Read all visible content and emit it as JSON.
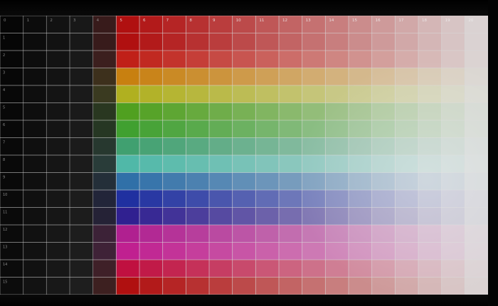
{
  "header_labels": [
    "0",
    "1",
    "2",
    "3",
    "4",
    "5",
    "6",
    "7",
    "8",
    "9",
    "10",
    "11",
    "12",
    "13",
    "14",
    "15",
    "16",
    "17",
    "18",
    "19",
    "20"
  ],
  "row_labels": [
    "1",
    "2",
    "3",
    "4",
    "5",
    "6",
    "7",
    "8",
    "9",
    "10",
    "11",
    "12",
    "13",
    "14",
    "15"
  ],
  "colors": {
    "bezel": "#000000",
    "gridline": "#d8d8d8",
    "saturated_row_0": "#b01010",
    "saturated_row_1": "#c02018",
    "saturated_row_2": "#c88010",
    "saturated_row_3": "#b0b020",
    "saturated_row_4": "#50a020",
    "saturated_row_5": "#40a030",
    "saturated_row_6": "#40a070",
    "saturated_row_7": "#50b8a8",
    "saturated_row_8": "#3070a8",
    "saturated_row_9": "#2030a0",
    "saturated_row_10": "#302090",
    "saturated_row_11": "#b02090",
    "saturated_row_12": "#c02090",
    "saturated_row_13": "#c01040",
    "saturated_row_14": "#b01010",
    "highlight_color": "#dcdcdc"
  }
}
